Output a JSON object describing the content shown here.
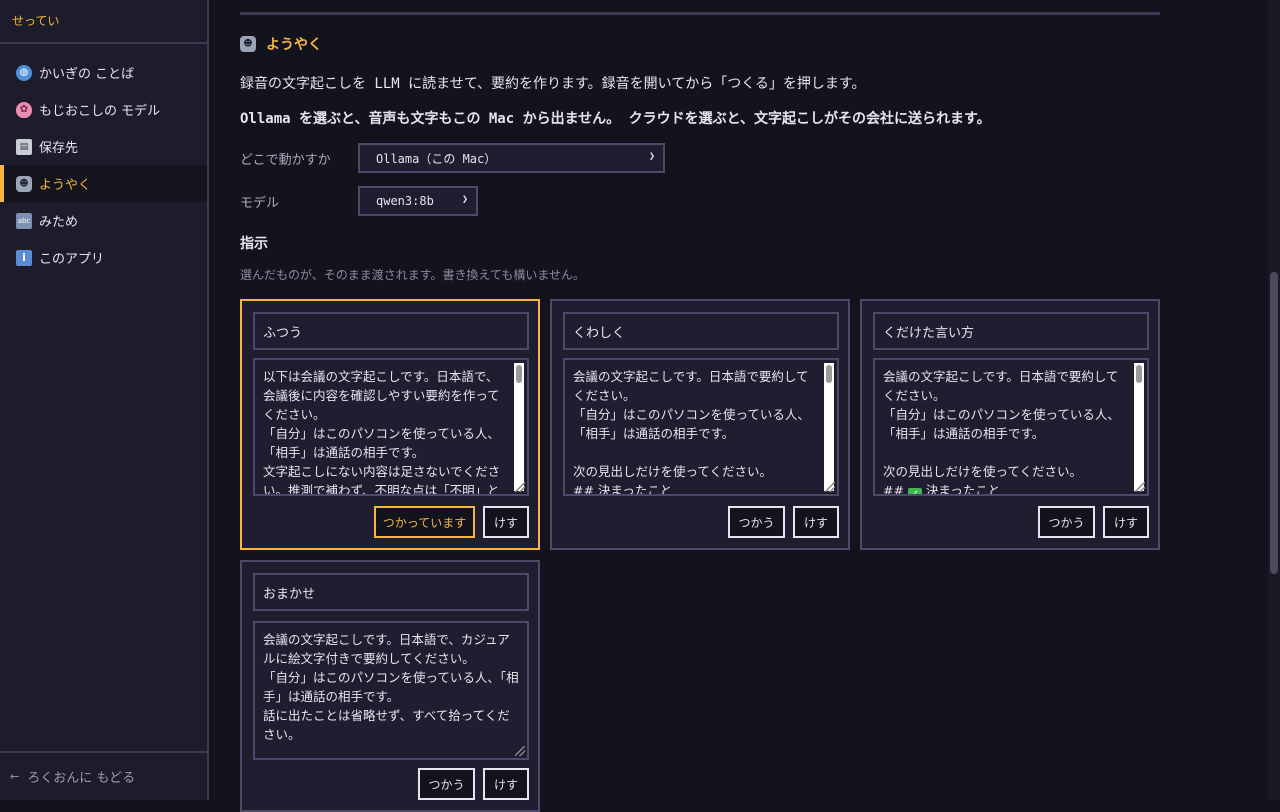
{
  "sidebar": {
    "title": "せってい",
    "items": [
      {
        "label": "かいぎの ことば",
        "icon": "globe-icon",
        "active": false
      },
      {
        "label": "もじおこしの モデル",
        "icon": "brain-icon",
        "active": false
      },
      {
        "label": "保存先",
        "icon": "floppy-disk-icon",
        "active": false
      },
      {
        "label": "ようやく",
        "icon": "robot-icon",
        "active": true
      },
      {
        "label": "みため",
        "icon": "abc-input-icon",
        "active": false
      },
      {
        "label": "このアプリ",
        "icon": "info-icon",
        "active": false
      }
    ],
    "back_label": "ろくおんに もどる"
  },
  "section": {
    "title": "ようやく",
    "description_1": "録音の文字起こしを LLM に読ませて、要約を作ります。録音を開いてから「つくる」を押します。",
    "description_2": "Ollama を選ぶと、音声も文字もこの Mac から出ません。 クラウドを選ぶと、文字起こしがその会社に送られます。"
  },
  "provider": {
    "label": "どこで動かすか",
    "value": "Ollama（この Mac）"
  },
  "model": {
    "label": "モデル",
    "value": "qwen3:8b"
  },
  "instructions": {
    "heading": "指示",
    "subtext": "選んだものが、そのまま渡されます。書き換えても構いません。",
    "cards": [
      {
        "name": "ふつう",
        "text": "以下は会議の文字起こしです。日本語で、会議後に内容を確認しやすい要約を作ってください。\n「自分」はこのパソコンを使っている人、「相手」は通話の相手です。\n文字起こしにない内容は足さないでください。推測で補わず、不明な点は「不明」と書",
        "active": true,
        "use_label": "つかっています",
        "delete_label": "けす"
      },
      {
        "name": "くわしく",
        "text": "会議の文字起こしです。日本語で要約してください。\n「自分」はこのパソコンを使っている人、「相手」は通話の相手です。\n\n次の見出しだけを使ってください。\n## 決まったこと",
        "active": false,
        "use_label": "つかう",
        "delete_label": "けす"
      },
      {
        "name": "くだけた言い方",
        "text_before": "会議の文字起こしです。日本語で要約してください。\n「自分」はこのパソコンを使っている人、「相手」は通話の相手です。\n\n次の見出しだけを使ってください。\n## ",
        "text_emoji": "✓",
        "text_after": " 決まったこと",
        "active": false,
        "use_label": "つかう",
        "delete_label": "けす"
      },
      {
        "name": "おまかせ",
        "text": "会議の文字起こしです。日本語で、カジュアルに絵文字付きで要約してください。\n「自分」はこのパソコンを使っている人、「相手」は通話の相手です。\n話に出たことは省略せず、すべて拾ってください。",
        "active": false,
        "use_label": "つかう",
        "delete_label": "けす"
      }
    ]
  },
  "colors": {
    "accent": "#f4b63f",
    "background": "#13131d",
    "panel": "#1e1e30",
    "border": "#4c4a68"
  }
}
